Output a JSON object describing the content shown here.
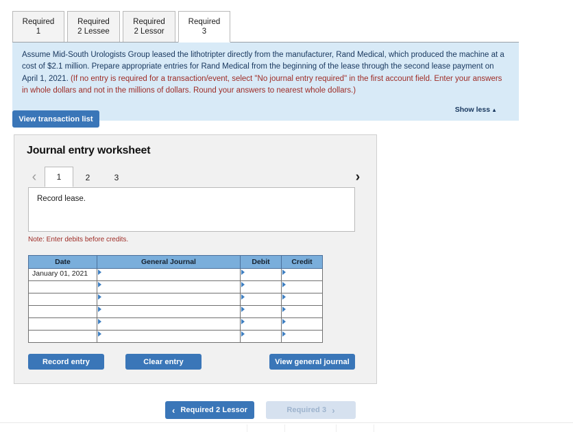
{
  "tabs": [
    {
      "label": "Required 1",
      "active": false
    },
    {
      "label": "Required 2 Lessee",
      "active": false
    },
    {
      "label": "Required 2 Lessor",
      "active": false
    },
    {
      "label": "Required 3",
      "active": true
    }
  ],
  "instructions": {
    "paragraph_part1": "Assume Mid-South Urologists Group leased the lithotripter directly from the manufacturer, Rand Medical, which produced the machine at a cost of $2.1 million. Prepare appropriate entries for Rand Medical from the beginning of the lease through the second lease payment on April 1, 2021. ",
    "paragraph_part2": "(If no entry is required for a transaction/event, select \"No journal entry required\" in the first account field. Enter your answers in whole dollars and not in the millions of dollars. Round your answers to nearest whole dollars.)",
    "show_less_label": "Show less",
    "show_less_caret": "▲",
    "panel_color": "#d8eaf7",
    "red_text_color": "#9e2b25"
  },
  "toolbar": {
    "view_transaction_list_label": "View transaction list"
  },
  "worksheet": {
    "title": "Journal entry worksheet",
    "pager": {
      "prev_icon": "‹",
      "next_icon": "›",
      "pages": [
        {
          "label": "1",
          "active": true
        },
        {
          "label": "2",
          "active": false
        },
        {
          "label": "3",
          "active": false
        }
      ]
    },
    "description": "Record lease.",
    "note": "Note: Enter debits before credits.",
    "table": {
      "headers": [
        "Date",
        "General Journal",
        "Debit",
        "Credit"
      ],
      "rows": [
        {
          "date": "January 01, 2021",
          "general_journal": "",
          "debit": "",
          "credit": ""
        },
        {
          "date": "",
          "general_journal": "",
          "debit": "",
          "credit": ""
        },
        {
          "date": "",
          "general_journal": "",
          "debit": "",
          "credit": ""
        },
        {
          "date": "",
          "general_journal": "",
          "debit": "",
          "credit": ""
        },
        {
          "date": "",
          "general_journal": "",
          "debit": "",
          "credit": ""
        },
        {
          "date": "",
          "general_journal": "",
          "debit": "",
          "credit": ""
        }
      ]
    },
    "buttons": {
      "record_entry": "Record entry",
      "clear_entry": "Clear entry",
      "view_general_journal": "View general journal"
    }
  },
  "bottom_nav": {
    "prev_label": "Required 2 Lessor",
    "prev_icon": "‹",
    "next_label": "Required 3",
    "next_icon": "›",
    "next_disabled": true
  },
  "colors": {
    "primary_button": "#3a76b8",
    "table_header": "#7aaedb",
    "panel_background": "#f1f1f1"
  }
}
